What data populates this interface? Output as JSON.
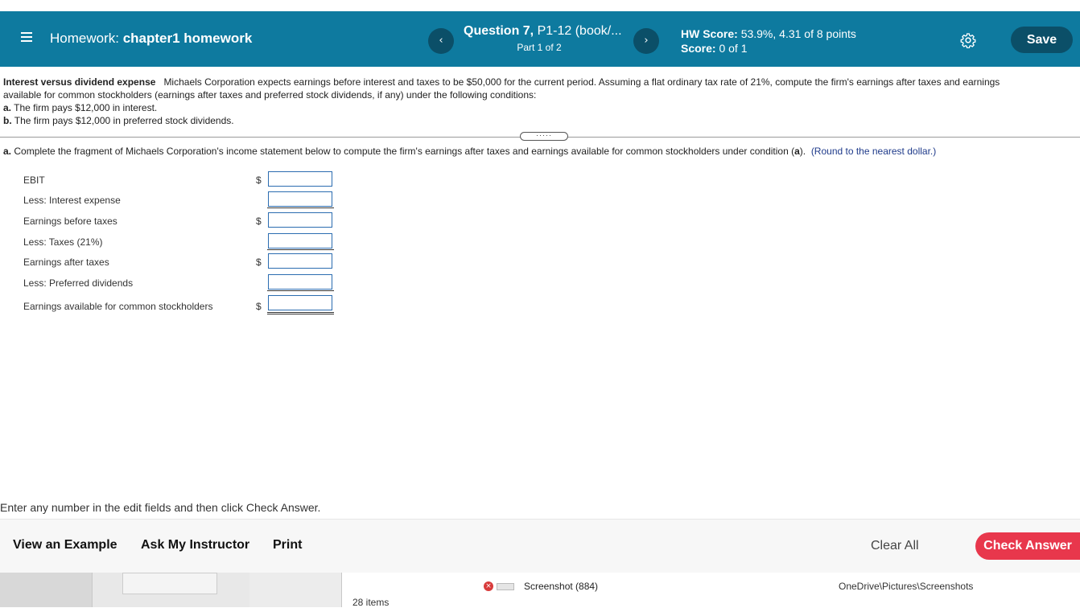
{
  "header": {
    "hw_prefix": "Homework:",
    "hw_name": "chapter1 homework",
    "question_bold": "Question 7,",
    "question_rest": "P1-12 (book/...",
    "part": "Part 1 of 2",
    "hw_score_label": "HW Score:",
    "hw_score_value": "53.9%, 4.31 of 8 points",
    "score_label": "Score:",
    "score_value": "0 of 1",
    "save_label": "Save",
    "prev_glyph": "‹",
    "next_glyph": "›"
  },
  "problem": {
    "lead": "Interest versus dividend expense",
    "line1": "Michaels Corporation expects earnings before interest and taxes to be $50,000 for the current period. Assuming a flat ordinary tax rate of 21%, compute the firm's earnings after taxes and earnings",
    "line2": "available for common stockholders (earnings after taxes and preferred stock dividends, if any) under the following conditions:",
    "cond_a_label": "a.",
    "cond_a_text": "The firm pays $12,000 in interest.",
    "cond_b_label": "b.",
    "cond_b_text": "The firm pays $12,000 in preferred stock dividends.",
    "expand_glyph": "·····"
  },
  "part_a": {
    "label": "a.",
    "instruction": "Complete the fragment of Michaels Corporation's income statement below to compute the firm's earnings after taxes and earnings available for common stockholders under condition (",
    "cond_letter": "a",
    "instruction_end": ").",
    "round_note": "(Round to the nearest dollar.)"
  },
  "statement": {
    "rows": [
      {
        "label": "EBIT",
        "dollar": "$",
        "value": ""
      },
      {
        "label": "Less: Interest expense",
        "dollar": "",
        "value": ""
      },
      {
        "label": "Earnings before taxes",
        "dollar": "$",
        "value": ""
      },
      {
        "label": "Less: Taxes (21%)",
        "dollar": "",
        "value": ""
      },
      {
        "label": "Earnings after taxes",
        "dollar": "$",
        "value": ""
      },
      {
        "label": "Less: Preferred dividends",
        "dollar": "",
        "value": ""
      },
      {
        "label": "Earnings available for common stockholders",
        "dollar": "$",
        "value": ""
      }
    ]
  },
  "footer": {
    "hint": "Enter any number in the edit fields and then click Check Answer.",
    "view_example": "View an Example",
    "ask_instructor": "Ask My Instructor",
    "print": "Print",
    "clear_all": "Clear All",
    "check_answer": "Check Answer"
  },
  "desktop": {
    "items_count": "28 items",
    "file_name": "Screenshot (884)",
    "file_path": "OneDrive\\Pictures\\Screenshots",
    "error_glyph": "×"
  },
  "colors": {
    "header_bg": "#0e7a9f",
    "button_dark": "#0b4f68",
    "check_answer_bg": "#e8374c",
    "input_border": "#2b6cb0",
    "round_note": "#1e3a8a"
  }
}
